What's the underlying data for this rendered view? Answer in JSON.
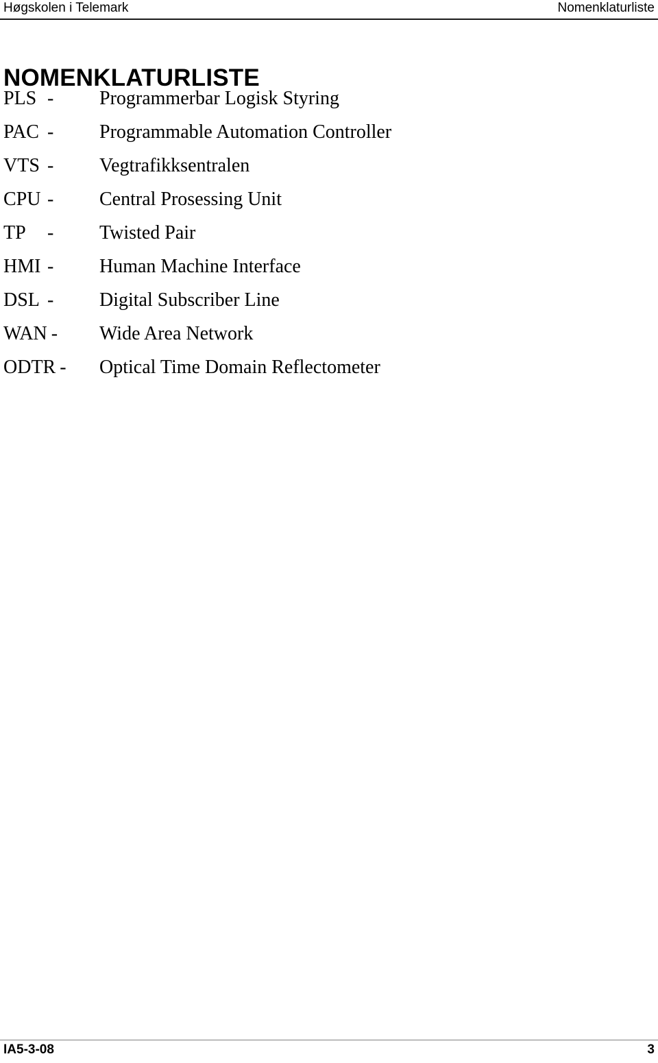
{
  "header": {
    "left": "Høgskolen i Telemark",
    "right": "Nomenklaturliste"
  },
  "title": "NOMENKLATURLISTE",
  "list": {
    "separator": "-",
    "entries": [
      {
        "abbr": "PLS",
        "sep": "-",
        "term": "Programmerbar Logisk Styring"
      },
      {
        "abbr": "PAC",
        "sep": "-",
        "term": "Programmable Automation Controller"
      },
      {
        "abbr": "VTS",
        "sep": "-",
        "term": "Vegtrafikksentralen"
      },
      {
        "abbr": "CPU",
        "sep": "-",
        "term": "Central Prosessing Unit"
      },
      {
        "abbr": "TP",
        "sep": "-",
        "term": "Twisted Pair"
      },
      {
        "abbr": "HMI",
        "sep": "-",
        "term": "Human Machine Interface"
      },
      {
        "abbr": "DSL",
        "sep": "-",
        "term": "Digital Subscriber Line"
      },
      {
        "abbr": "WAN",
        "sep": "-",
        "term": "Wide Area Network"
      },
      {
        "abbr": "ODTR",
        "sep": "-",
        "term": "Optical Time Domain Reflectometer"
      }
    ]
  },
  "footer": {
    "left": "IA5-3-08",
    "right": "3"
  }
}
